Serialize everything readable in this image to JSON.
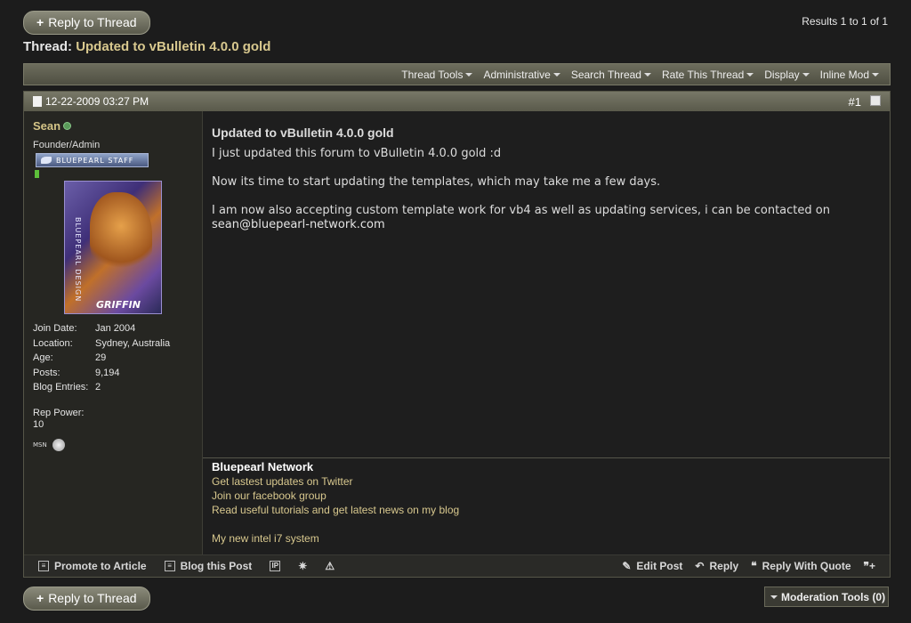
{
  "nav": {
    "reply_label": "Reply to Thread",
    "results": "Results 1 to 1 of 1"
  },
  "thread": {
    "prefix": "Thread:",
    "title": "Updated to vBulletin 4.0.0 gold"
  },
  "toolbar": {
    "items": [
      "Thread Tools",
      "Administrative",
      "Search Thread",
      "Rate This Thread",
      "Display",
      "Inline Mod"
    ]
  },
  "post": {
    "date": "12-22-2009 03:27 PM",
    "number": "#1",
    "title": "Updated to vBulletin 4.0.0 gold",
    "body": [
      "I just updated this forum to vBulletin 4.0.0 gold :d",
      "Now its time to start updating the templates, which may take me a few days.",
      "I am now also accepting custom template work for vb4 as well as updating services, i can be contacted on"
    ],
    "email": "sean@bluepearl-network.com"
  },
  "user": {
    "name": "Sean",
    "title": "Founder/Admin",
    "badge": "BLUEPEARL STAFF",
    "avatar_text": "BLUEPEARL DESIGN",
    "avatar_logo": "GRIFFIN",
    "stats": [
      {
        "key": "Join Date:",
        "value": "Jan 2004"
      },
      {
        "key": "Location:",
        "value": "Sydney, Australia"
      },
      {
        "key": "Age:",
        "value": "29"
      },
      {
        "key": "Posts:",
        "value": "9,194"
      },
      {
        "key": "Blog Entries:",
        "value": "2"
      }
    ],
    "rep_power_label": "Rep Power:",
    "rep_power_value": "10",
    "msn_label": "MSN"
  },
  "signature": {
    "heading": "Bluepearl Network",
    "lines": [
      "Get lastest updates on Twitter",
      "Join our facebook group",
      "Read useful tutorials and get latest news on my blog"
    ],
    "extra": "My new intel i7 system"
  },
  "footer": {
    "promote": "Promote to Article",
    "blog": "Blog this Post",
    "ip_icon": "IP",
    "edit": "Edit Post",
    "reply": "Reply",
    "quote": "Reply With Quote"
  },
  "moderation": {
    "label": "Moderation Tools (0)"
  },
  "colors": {
    "background": "#1c1c1c",
    "accent": "#d8c88e",
    "toolbar": "#5a5a4b"
  }
}
